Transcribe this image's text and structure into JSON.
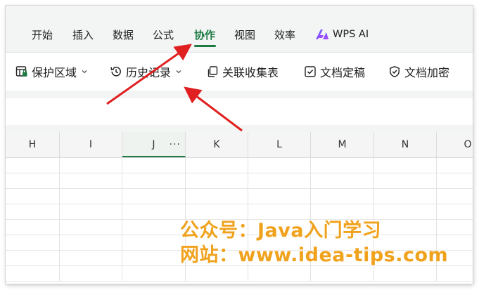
{
  "menu": {
    "tabs": [
      {
        "label": "开始"
      },
      {
        "label": "插入"
      },
      {
        "label": "数据"
      },
      {
        "label": "公式"
      },
      {
        "label": "协作",
        "active": true
      },
      {
        "label": "视图"
      },
      {
        "label": "效率"
      }
    ],
    "wps_ai_label": "WPS AI"
  },
  "toolbar": {
    "protect_area": "保护区域",
    "history": "历史记录",
    "linked_forms": "关联收集表",
    "finalize": "文档定稿",
    "encrypt": "文档加密"
  },
  "sheet": {
    "columns": [
      "H",
      "I",
      "J",
      "K",
      "L",
      "M",
      "N",
      "O"
    ],
    "selected_column": "J",
    "column_menu_glyph": "···"
  },
  "watermark": {
    "line1": "公众号：Java入门学习",
    "line2": "网站：www.idea-tips.com"
  },
  "colors": {
    "accent": "#1d7a43",
    "arrow": "#e02020",
    "watermark": "#f0a21d"
  },
  "icons": [
    "protect-area-icon",
    "history-icon",
    "copy-link-icon",
    "finalize-check-icon",
    "shield-check-icon",
    "wps-ai-logo-icon",
    "chevron-down-icon"
  ]
}
